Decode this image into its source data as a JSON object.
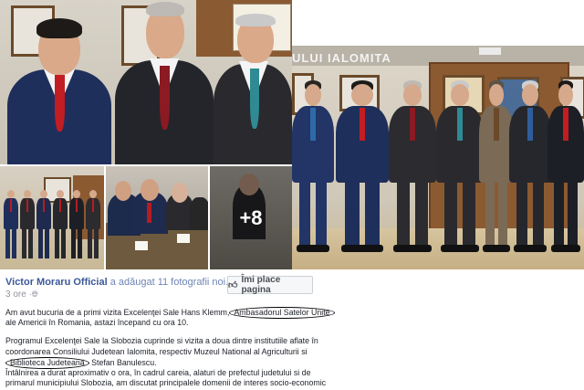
{
  "gallery": {
    "overlay_count": "+8",
    "banner_text": "ULUI IALOMITA"
  },
  "post": {
    "author_name": "Victor Moraru Official",
    "action_text": "a adăugat 11 fotografii noi.",
    "time": "3 ore",
    "like_button_label": "Îmi place pagina",
    "lines": {
      "l1_start": "Am avut bucuria de a primi vizita Excelenţei Sale Hans Klemm,",
      "l1_circled": "Ambasadorul Satelor Unite",
      "l2": "ale Americii în Romania, astazi începand cu ora 10.",
      "l3": "Programul Excelenţei Sale la Slobozia cuprinde si vizita a doua dintre institutiile aflate în",
      "l4": "coordonarea Consiliului Judetean Ialomita, respectiv Muzeul National al Agriculturii si",
      "l5_circled": "Biblioteca Judeteană",
      "l5_end": " Stefan Banulescu.",
      "l6": "Întâlnirea a durat aproximativ o ora, în cadrul careia, alaturi de prefectul judetului si de",
      "l7": "primarul municipiului Slobozia, am discutat principalele domenii de interes socio-economic"
    }
  },
  "colors": {
    "facebook_blue": "#3b5998",
    "link_blue": "#6d84b4",
    "muted_gray": "#90949c"
  }
}
